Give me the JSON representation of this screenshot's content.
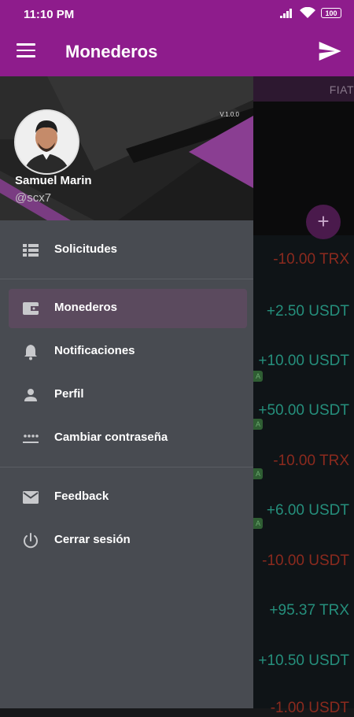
{
  "status_bar": {
    "time": "11:10 PM",
    "battery": "100"
  },
  "app_bar": {
    "title": "Monederos"
  },
  "background": {
    "tab_label": "FIAT",
    "fab_label": "+",
    "chip_label": "A",
    "transactions": [
      {
        "amount": "-10.00 TRX",
        "type": "neg"
      },
      {
        "amount": "+2.50 USDT",
        "type": "pos"
      },
      {
        "amount": "+10.00 USDT",
        "type": "pos"
      },
      {
        "amount": "+50.00 USDT",
        "type": "pos"
      },
      {
        "amount": "-10.00 TRX",
        "type": "neg"
      },
      {
        "amount": "+6.00 USDT",
        "type": "pos"
      },
      {
        "amount": "-10.00 USDT",
        "type": "neg"
      },
      {
        "amount": "+95.37 TRX",
        "type": "pos"
      },
      {
        "amount": "+10.50 USDT",
        "type": "pos"
      },
      {
        "amount": "-1.00 USDT",
        "type": "neg"
      }
    ]
  },
  "drawer": {
    "version": "V.1.0.0",
    "user_name": "Samuel Marin",
    "user_handle": "@scx7",
    "menu": [
      {
        "label": "Solicitudes",
        "icon": "list-icon"
      },
      {
        "label": "Monederos",
        "icon": "wallet-icon",
        "active": true
      },
      {
        "label": "Notificaciones",
        "icon": "bell-icon"
      },
      {
        "label": "Perfil",
        "icon": "person-icon"
      },
      {
        "label": "Cambiar contraseña",
        "icon": "password-icon"
      },
      {
        "label": "Feedback",
        "icon": "mail-icon"
      },
      {
        "label": "Cerrar sesión",
        "icon": "power-icon"
      }
    ]
  },
  "colors": {
    "accent": "#8e1c8c",
    "drawer_bg": "#484b51",
    "positive": "#258f7c",
    "negative": "#8b2a1e"
  }
}
